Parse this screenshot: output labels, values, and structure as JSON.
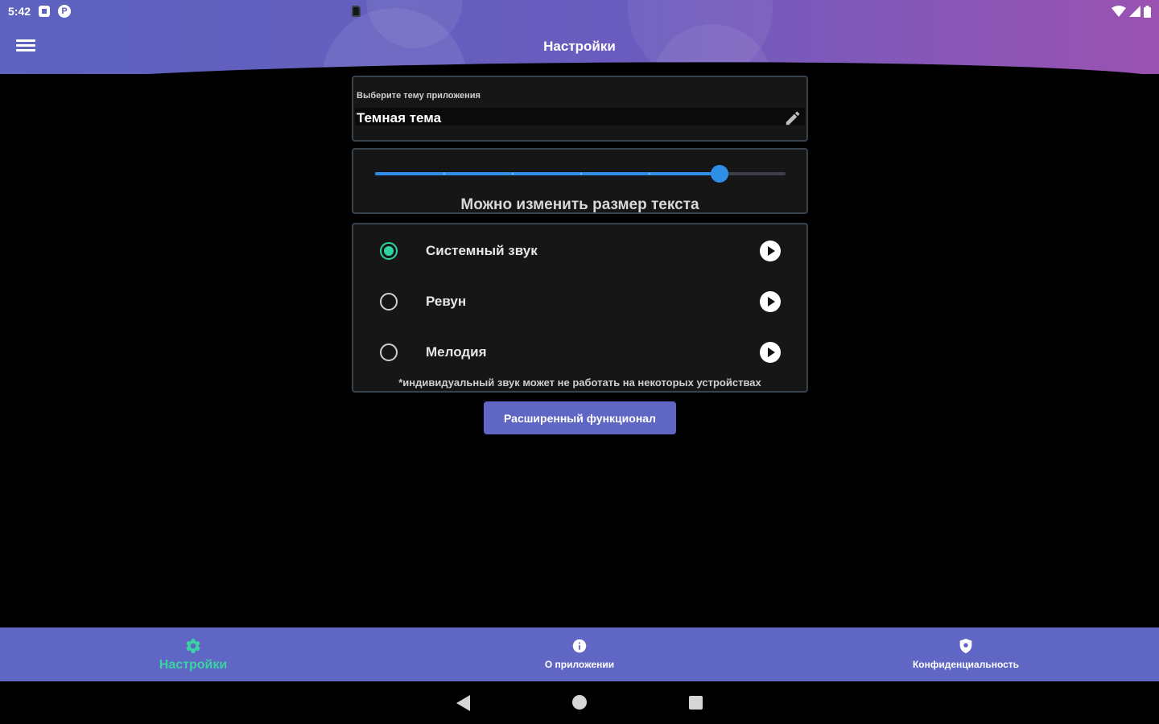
{
  "status_bar": {
    "time": "5:42",
    "icons": [
      "notification-icon",
      "p-icon",
      "sd-card-icon",
      "wifi-icon",
      "signal-icon",
      "battery-icon"
    ],
    "p_icon_letter": "P"
  },
  "app_bar": {
    "menu_icon": "hamburger-menu-icon",
    "title": "Настройки"
  },
  "theme": {
    "label": "Выберите тему приложения",
    "value": "Темная тема",
    "edit_icon": "pencil-icon"
  },
  "text_size": {
    "label": "Можно изменить размер текста",
    "level": 0.84,
    "ticks": 6
  },
  "sounds": {
    "options": [
      {
        "label": "Системный звук",
        "selected": true
      },
      {
        "label": "Ревун",
        "selected": false
      },
      {
        "label": "Мелодия",
        "selected": false
      }
    ],
    "play_icon": "play-icon",
    "note": "*индивидуальный звук может не работать на некоторых устройствах"
  },
  "extended_button": {
    "label": "Расширенный функционал"
  },
  "bottom_nav": {
    "items": [
      {
        "label": "Настройки",
        "icon": "gear-icon",
        "active": true
      },
      {
        "label": "О приложении",
        "icon": "info-icon",
        "active": false
      },
      {
        "label": "Конфиденциальность",
        "icon": "shield-icon",
        "active": false
      }
    ]
  },
  "system_nav": {
    "icons": [
      "back-icon",
      "home-icon",
      "recents-icon"
    ]
  },
  "colors": {
    "header_start": "#5d63bf",
    "header_end": "#9a52b0",
    "accent_green": "#3ad4a2",
    "slider_blue": "#2f8fe8",
    "nav_bar": "#5f66c3",
    "card_bg": "#161616"
  }
}
